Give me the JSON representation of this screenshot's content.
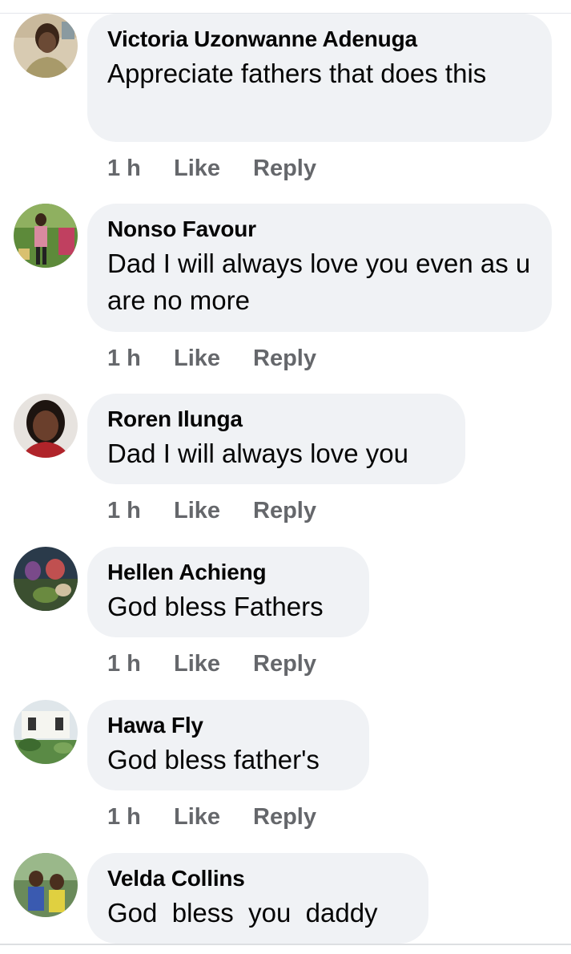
{
  "comments": [
    {
      "author": "Victoria Uzonwanne Adenuga",
      "text": "Appreciate fathers that does this",
      "time": "1 h",
      "like_label": "Like",
      "reply_label": "Reply",
      "avatar_icon": "profile-photo-icon"
    },
    {
      "author": "Nonso Favour",
      "text": "Dad I will always love you even as u are no more",
      "time": "1 h",
      "like_label": "Like",
      "reply_label": "Reply",
      "avatar_icon": "profile-photo-icon"
    },
    {
      "author": "Roren Ilunga",
      "text": "Dad I will always love you",
      "time": "1 h",
      "like_label": "Like",
      "reply_label": "Reply",
      "avatar_icon": "profile-photo-icon"
    },
    {
      "author": "Hellen Achieng",
      "text": "God bless Fathers",
      "time": "1 h",
      "like_label": "Like",
      "reply_label": "Reply",
      "avatar_icon": "profile-photo-icon"
    },
    {
      "author": "Hawa Fly",
      "text": "God bless father's",
      "time": "1 h",
      "like_label": "Like",
      "reply_label": "Reply",
      "avatar_icon": "profile-photo-icon"
    },
    {
      "author": "Velda Collins",
      "text": "God  bless  you  daddy",
      "avatar_icon": "profile-photo-icon"
    }
  ],
  "colors": {
    "bubble_background": "#f0f2f5",
    "author_text": "#050505",
    "action_text": "#65676b"
  }
}
